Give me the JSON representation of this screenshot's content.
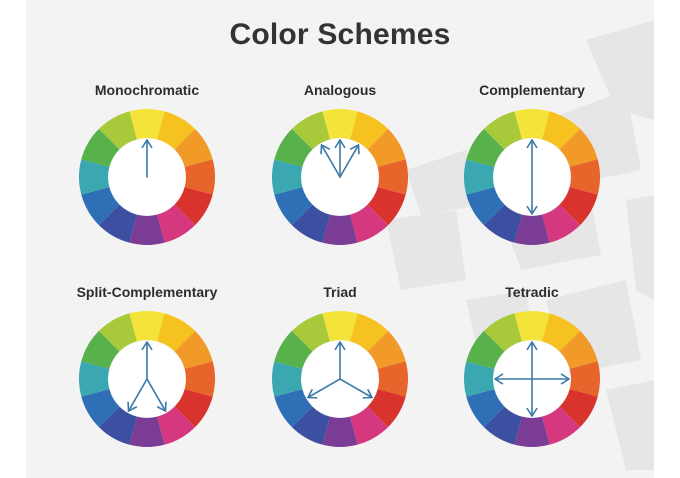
{
  "title": "Color Schemes",
  "wheel_colors": [
    "#f4e43a",
    "#f5c21f",
    "#f19a28",
    "#e7642b",
    "#d8342d",
    "#d5387f",
    "#7b3c96",
    "#3d4fa1",
    "#2f6fb6",
    "#3ba7b0",
    "#58b14a",
    "#a7c93a"
  ],
  "arrow_color": "#3a7aa8",
  "schemes": [
    {
      "label": "Monochromatic",
      "arrows": [
        0
      ]
    },
    {
      "label": "Analogous",
      "arrows": [
        11,
        0,
        1
      ]
    },
    {
      "label": "Complementary",
      "arrows": [
        0,
        6
      ]
    },
    {
      "label": "Split-Complementary",
      "arrows": [
        0,
        5,
        7
      ]
    },
    {
      "label": "Triad",
      "arrows": [
        0,
        4,
        8
      ]
    },
    {
      "label": "Tetradic",
      "arrows": [
        0,
        3,
        6,
        9
      ]
    }
  ]
}
